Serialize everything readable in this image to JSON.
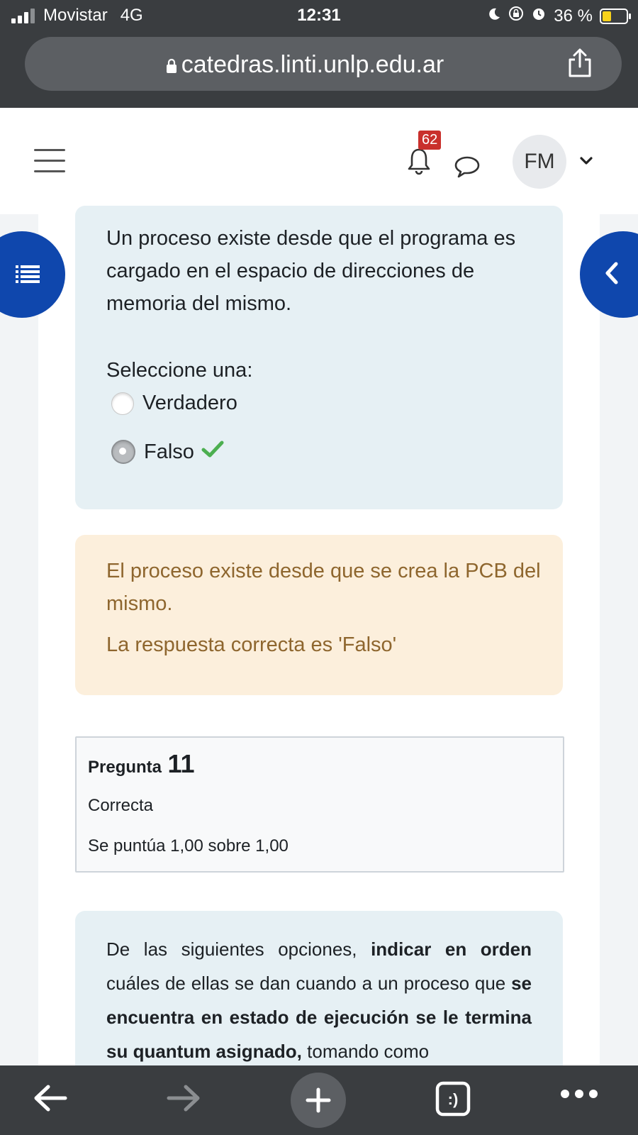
{
  "status_bar": {
    "carrier": "Movistar",
    "network": "4G",
    "time": "12:31",
    "battery": "36 %",
    "icons": [
      "signal-icon",
      "moon-icon",
      "orientation-lock-icon",
      "alarm-icon",
      "battery-icon"
    ]
  },
  "browser": {
    "url": "catedras.linti.unlp.edu.ar",
    "icons": [
      "lock-icon",
      "share-icon"
    ]
  },
  "header": {
    "notification_count": "62",
    "avatar_initials": "FM",
    "icons": [
      "hamburger-menu-icon",
      "bell-icon",
      "chat-bubble-icon",
      "chevron-down-icon"
    ]
  },
  "question": {
    "text": "Un proceso existe desde que el programa es cargado en el espacio de direcciones de memoria del mismo.",
    "prompt": "Seleccione una:",
    "options": [
      {
        "label": "Verdadero",
        "selected": false
      },
      {
        "label": "Falso",
        "selected": true,
        "correct": true
      }
    ]
  },
  "feedback": {
    "explanation": "El proceso existe desde que se crea la PCB del mismo.",
    "correct_answer": "La respuesta correcta es 'Falso'"
  },
  "question_info": {
    "label": "Pregunta",
    "number": "11",
    "state": "Correcta",
    "grade": "Se puntúa 1,00 sobre 1,00"
  },
  "next_question": {
    "t1": "De las siguientes opciones, ",
    "b1": "indicar en orden",
    "t2": " cuáles de ellas se dan cuando a un proceso que ",
    "b2": "se encuentra en estado de ejecución se le termina su quantum asignado,",
    "t3": " tomando como"
  },
  "toolbar": {
    "icons": [
      "back-arrow-icon",
      "forward-arrow-icon",
      "new-tab-plus-icon",
      "tabs-icon",
      "more-options-icon"
    ],
    "tabs_label": ":)"
  },
  "colors": {
    "primary": "#0f47ad",
    "question_bg": "#e6f0f4",
    "feedback_bg": "#fcefdc",
    "feedback_text": "#8e662e",
    "badge": "#c9302c",
    "check": "#4caf50"
  }
}
